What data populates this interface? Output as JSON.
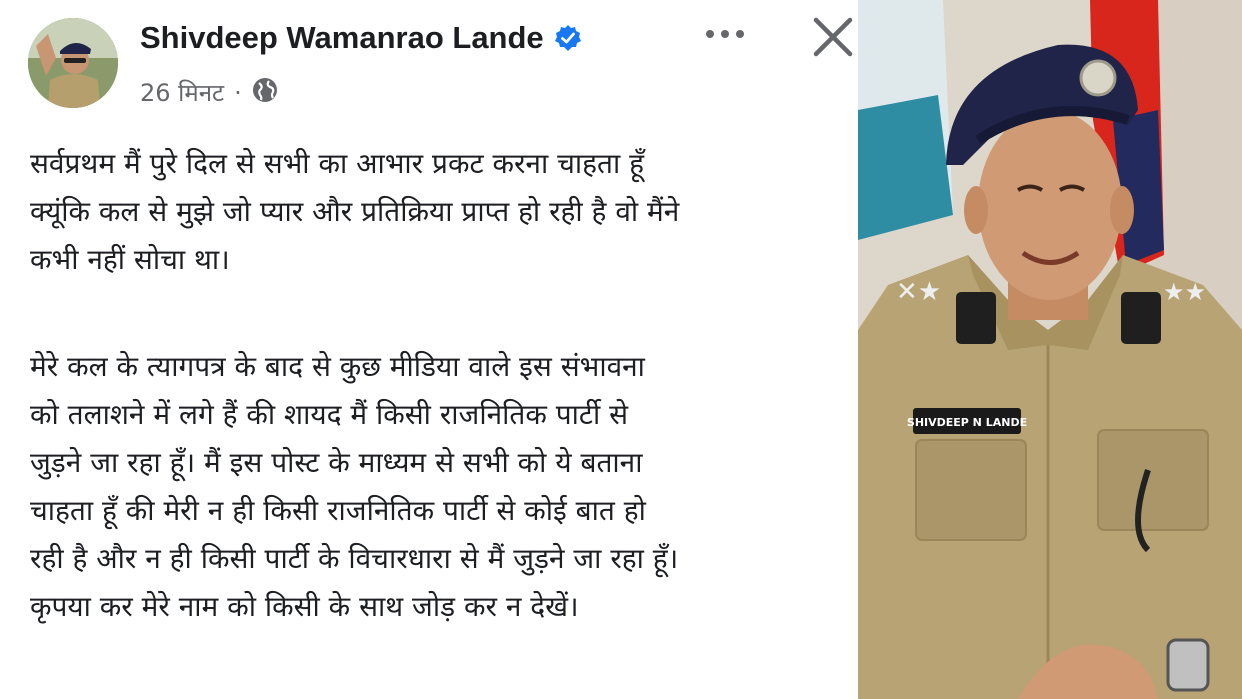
{
  "post": {
    "author_name": "Shivdeep Wamanrao Lande",
    "time_ago": "26 मिनट",
    "separator": "·",
    "privacy_icon": "globe-icon",
    "verified_icon": "verified-badge-icon",
    "more_icon": "more-options-icon",
    "close_icon": "close-icon",
    "paragraphs": [
      {
        "lines": [
          "सर्वप्रथम मैं पुरे दिल से सभी का आभार प्रकट करना चाहता हूँ",
          "क्यूंकि कल से मुझे जो प्यार और प्रतिक्रिया प्राप्त हो रही है वो मैंने",
          "कभी नहीं सोचा था।"
        ]
      },
      {
        "lines": [
          "मेरे कल के त्यागपत्र के बाद से कुछ मीडिया वाले इस संभावना",
          "को तलाशने में लगे हैं की शायद मैं किसी राजनितिक पार्टी से",
          "जुड़ने जा रहा हूँ। मैं इस पोस्ट के माध्यम से सभी को ये बताना",
          "चाहता हूँ की मेरी न ही किसी राजनितिक पार्टी से कोई बात हो",
          "रही है और न ही किसी पार्टी के विचारधारा से मैं जुड़ने जा रहा हूँ।",
          "कृपया कर मेरे नाम को किसी के साथ जोड़ कर न देखें।"
        ]
      }
    ]
  },
  "photo": {
    "badge_text": "SHIVDEEP N LANDE"
  },
  "colors": {
    "verified": "#1877f2",
    "text": "#1c1e21",
    "secondary_text": "#65676b",
    "uniform": "#b8a374",
    "beret": "#1f2448"
  }
}
